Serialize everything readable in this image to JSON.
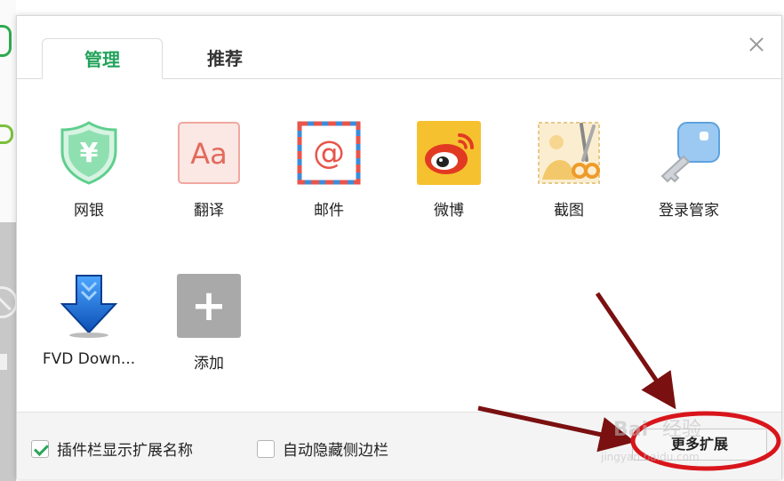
{
  "tabs": [
    {
      "label": "管理",
      "active": true
    },
    {
      "label": "推荐",
      "active": false
    }
  ],
  "extensions": [
    {
      "label": "网银",
      "icon": "shield-yen-icon"
    },
    {
      "label": "翻译",
      "icon": "translate-aa-icon"
    },
    {
      "label": "邮件",
      "icon": "mail-at-icon"
    },
    {
      "label": "微博",
      "icon": "weibo-icon"
    },
    {
      "label": "截图",
      "icon": "screenshot-scissors-icon"
    },
    {
      "label": "登录管家",
      "icon": "key-icon"
    },
    {
      "label": "FVD Down...",
      "icon": "download-arrow-icon"
    },
    {
      "label": "添加",
      "icon": "add-plus-icon"
    }
  ],
  "icon_glyphs": {
    "yen": "¥",
    "aa": "Aa",
    "at": "@",
    "plus": "+"
  },
  "footer": {
    "show_names_label": "插件栏显示扩展名称",
    "show_names_checked": true,
    "auto_hide_label": "自动隐藏侧边栏",
    "auto_hide_checked": false,
    "more_button_label": "更多扩展"
  },
  "watermark": {
    "brand": "Bai",
    "brand_cn": "经验",
    "url": "jingyan.baidu.com"
  },
  "colors": {
    "accent_green": "#22a35a",
    "annotation_red": "#d8151b",
    "arrow_dark_red": "#7a1010"
  }
}
